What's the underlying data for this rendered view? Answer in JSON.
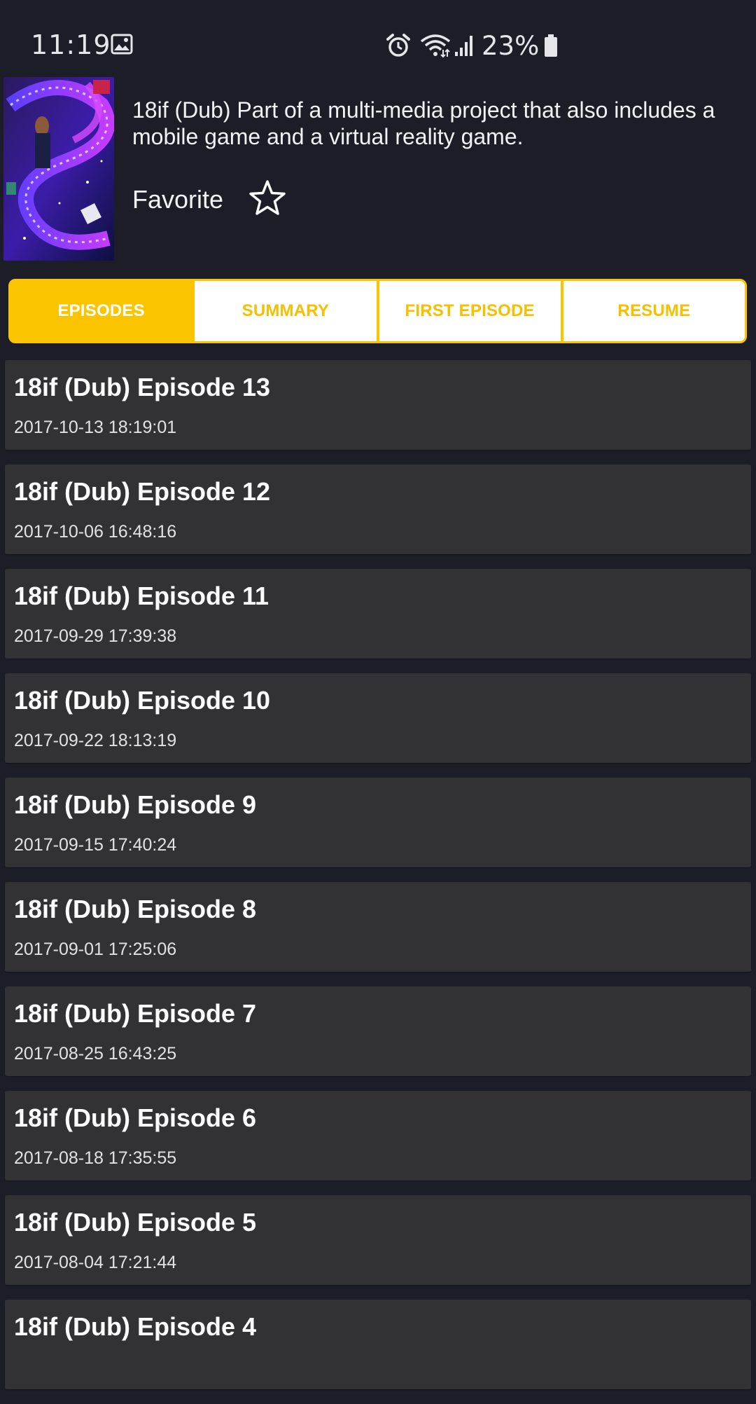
{
  "status_bar": {
    "time": "11:19",
    "battery": "23%",
    "icons": [
      "gallery-icon",
      "alarm-icon",
      "wifi-icon",
      "signal-icon",
      "battery-icon"
    ]
  },
  "show": {
    "description": "18if (Dub) Part of a multi-media project that also includes a mobile game and a virtual reality game.",
    "favorite_label": "Favorite",
    "favorite_icon": "star-outline-icon"
  },
  "tabs": [
    {
      "label": "EPISODES",
      "active": true
    },
    {
      "label": "SUMMARY",
      "active": false
    },
    {
      "label": "FIRST EPISODE",
      "active": false
    },
    {
      "label": "RESUME",
      "active": false
    }
  ],
  "episodes": [
    {
      "title": "18if (Dub) Episode 13",
      "date": "2017-10-13 18:19:01"
    },
    {
      "title": "18if (Dub) Episode 12",
      "date": "2017-10-06 16:48:16"
    },
    {
      "title": "18if (Dub) Episode 11",
      "date": "2017-09-29 17:39:38"
    },
    {
      "title": "18if (Dub) Episode 10",
      "date": "2017-09-22 18:13:19"
    },
    {
      "title": "18if (Dub) Episode 9",
      "date": "2017-09-15 17:40:24"
    },
    {
      "title": "18if (Dub) Episode 8",
      "date": "2017-09-01 17:25:06"
    },
    {
      "title": "18if (Dub) Episode 7",
      "date": "2017-08-25 16:43:25"
    },
    {
      "title": "18if (Dub) Episode 6",
      "date": "2017-08-18 17:35:55"
    },
    {
      "title": "18if (Dub) Episode 5",
      "date": "2017-08-04 17:21:44"
    },
    {
      "title": "18if (Dub) Episode 4",
      "date": ""
    }
  ],
  "colors": {
    "background": "#1c1d26",
    "accent": "#fbc400",
    "card": "#323234"
  }
}
